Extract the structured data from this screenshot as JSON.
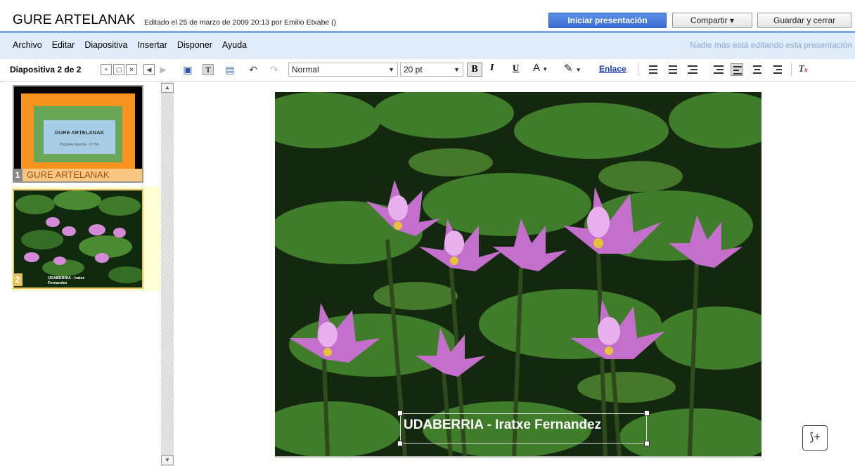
{
  "header": {
    "title": "GURE ARTELANAK",
    "edited": "Editado el 25 de marzo de 2009 20:13 por Emilio Etxabe ()",
    "start_label": "Iniciar presentación",
    "share_label": "Compartir ▾",
    "save_close_label": "Guardar y cerrar"
  },
  "menu": {
    "items": [
      "Archivo",
      "Editar",
      "Diapositiva",
      "Insertar",
      "Disponer",
      "Ayuda"
    ],
    "status": "Nadie más está editando esta presentación"
  },
  "toolbar": {
    "slide_counter": "Diapositiva 2 de 2",
    "style_value": "Normal",
    "size_value": "20 pt",
    "bold": "B",
    "italic": "I",
    "underline": "U",
    "font_color": "A",
    "link_label": "Enlace"
  },
  "slides": {
    "items": [
      {
        "number": "1",
        "title": "GURE ARTELANAK",
        "thumb_title": "GURE ARTELANAK",
        "thumb_subtitle": "Pagoeta Ikastola - LH 5A"
      },
      {
        "number": "2",
        "title": "UDABERRIA - Iratxe Fernandez",
        "thumb_caption_1": "UDABERRIA - Iratxe",
        "thumb_caption_2": "Fernandez"
      }
    ]
  },
  "canvas": {
    "slide_title": "UDABERRIA - Iratxe Fernandez",
    "add_note": "⟆+"
  },
  "colors": {
    "accent_blue": "#3a6fd6",
    "menu_bg": "#e1ecfa",
    "thumb_orange": "#f7931e",
    "selected_bg": "#ffffd6"
  }
}
